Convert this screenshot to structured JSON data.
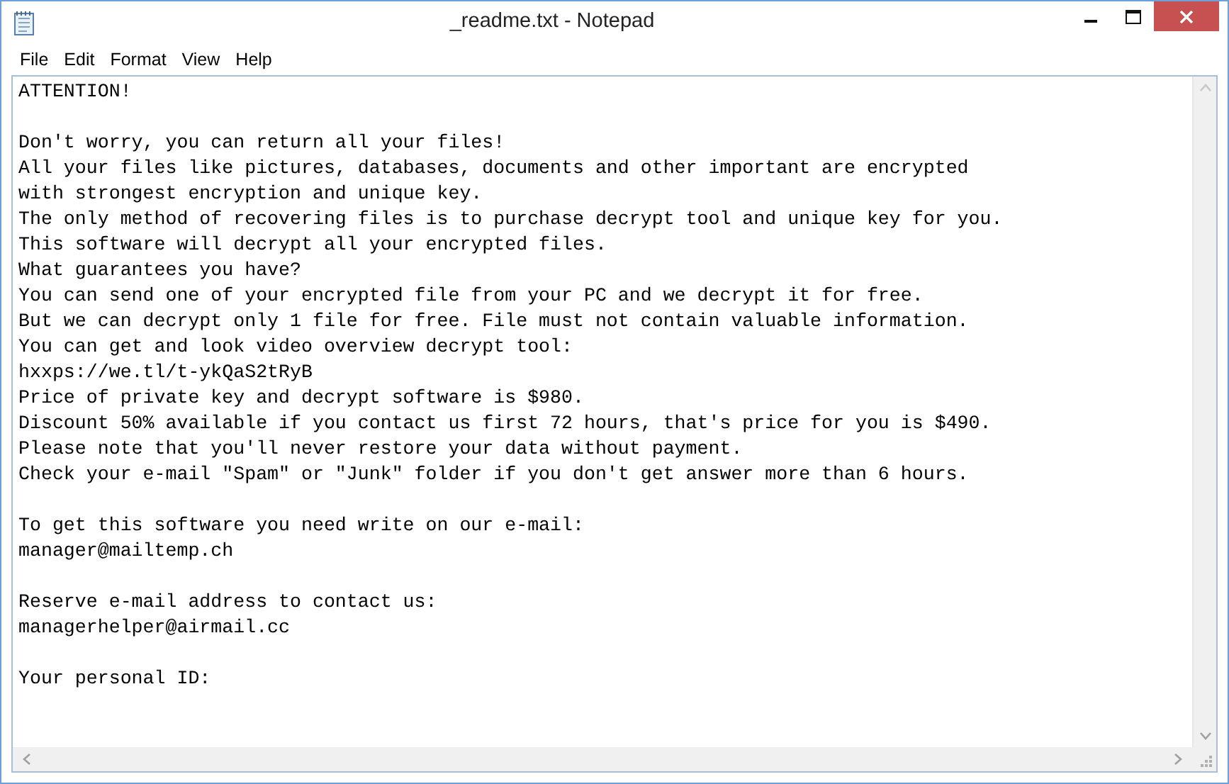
{
  "window": {
    "title": "_readme.txt - Notepad"
  },
  "menu": [
    "File",
    "Edit",
    "Format",
    "View",
    "Help"
  ],
  "document": {
    "paragraphs": [
      [
        "ATTENTION!"
      ],
      [
        "Don't worry, you can return all your files!",
        "All your files like pictures, databases, documents and other important are encrypted",
        "with strongest encryption and unique key.",
        "The only method of recovering files is to purchase decrypt tool and unique key for you.",
        "This software will decrypt all your encrypted files.",
        "What guarantees you have?",
        "You can send one of your encrypted file from your PC and we decrypt it for free.",
        "But we can decrypt only 1 file for free. File must not contain valuable information.",
        "You can get and look video overview decrypt tool:",
        "hxxps://we.tl/t-ykQaS2tRyB",
        "Price of private key and decrypt software is $980.",
        "Discount 50% available if you contact us first 72 hours, that's price for you is $490.",
        "Please note that you'll never restore your data without payment.",
        "Check your e-mail \"Spam\" or \"Junk\" folder if you don't get answer more than 6 hours."
      ],
      [
        "To get this software you need write on our e-mail:",
        "manager@mailtemp.ch"
      ],
      [
        "Reserve e-mail address to contact us:",
        "managerhelper@airmail.cc"
      ],
      [
        "Your personal ID:"
      ]
    ]
  }
}
